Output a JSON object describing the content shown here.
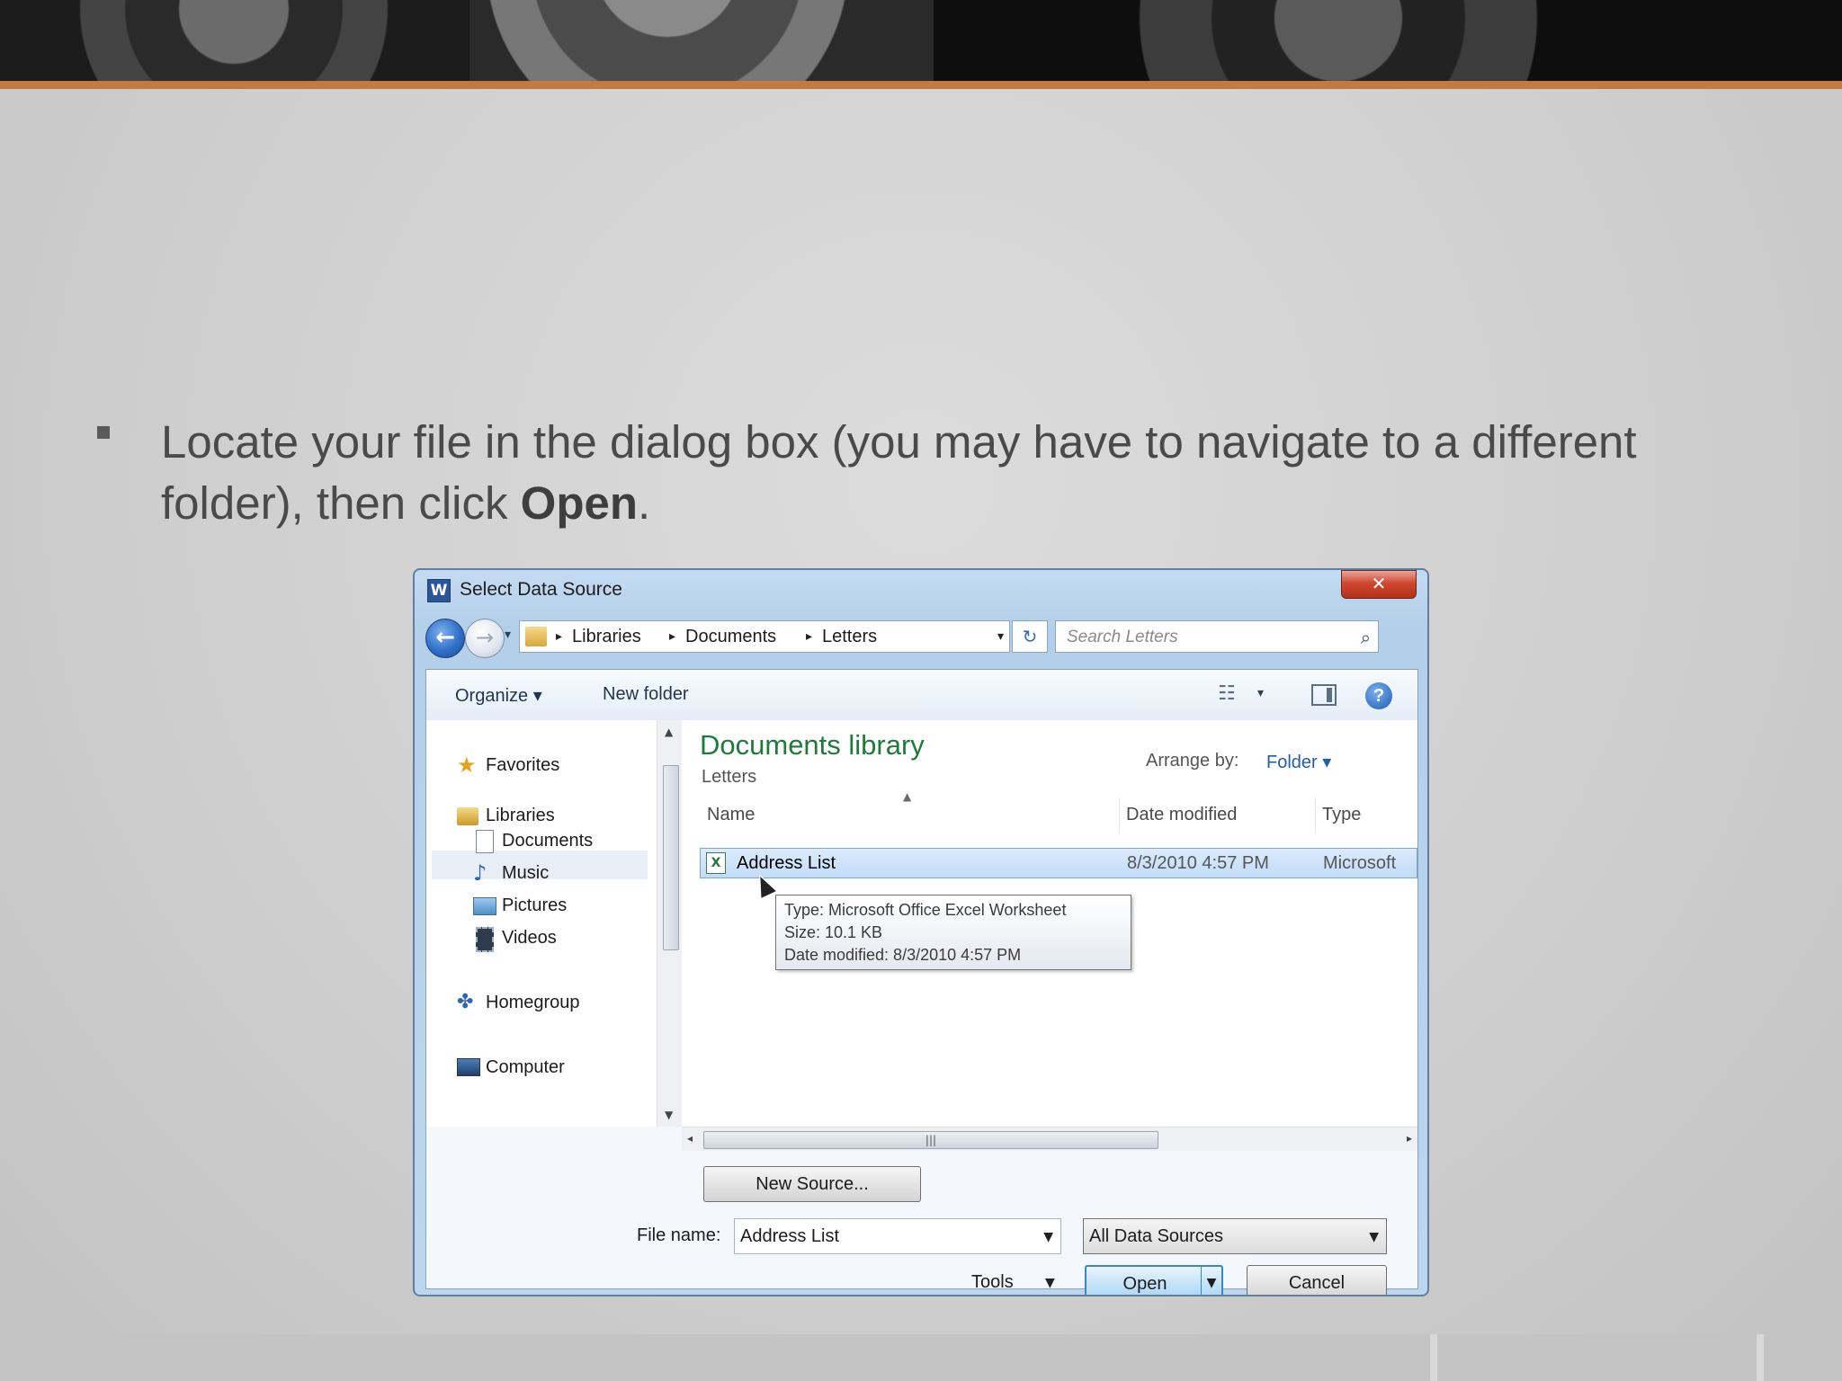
{
  "slide": {
    "instruction_prefix": "Locate your file in the dialog box (you may have to navigate to a different folder), then click ",
    "instruction_bold": "Open",
    "instruction_suffix": "."
  },
  "dialog": {
    "title": "Select Data Source",
    "close_label": "✕",
    "breadcrumb": [
      "Libraries",
      "Documents",
      "Letters"
    ],
    "search_placeholder": "Search Letters",
    "toolbar": {
      "organize": "Organize ▾",
      "new_folder": "New folder"
    },
    "nav": {
      "favorites": "Favorites",
      "libraries": "Libraries",
      "documents": "Documents",
      "music": "Music",
      "pictures": "Pictures",
      "videos": "Videos",
      "homegroup": "Homegroup",
      "computer": "Computer"
    },
    "library_title": "Documents library",
    "library_sub": "Letters",
    "arrange_label": "Arrange by:",
    "arrange_value": "Folder ▾",
    "columns": {
      "name": "Name",
      "date": "Date modified",
      "type": "Type"
    },
    "file": {
      "name": "Address List",
      "date": "8/3/2010 4:57 PM",
      "type": "Microsoft"
    },
    "tooltip": {
      "type": "Type: Microsoft Office Excel Worksheet",
      "size": "Size: 10.1 KB",
      "date": "Date modified: 8/3/2010 4:57 PM"
    },
    "new_source_label": "New Source...",
    "file_name_label": "File name:",
    "file_name_value": "Address List",
    "filter_value": "All Data Sources",
    "tools_label": "Tools",
    "open_label": "Open",
    "cancel_label": "Cancel"
  },
  "colors": {
    "accent": "#c27a3d",
    "library_title": "#1e7b3a",
    "link": "#1f5faa"
  }
}
